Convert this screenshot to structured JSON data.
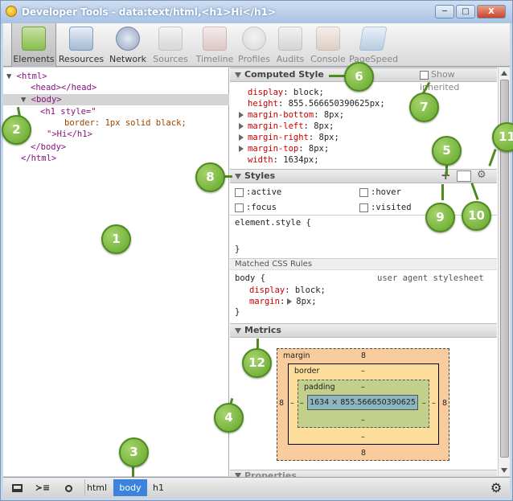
{
  "window": {
    "title": "Developer Tools - data:text/html,<h1>Hi</h1>",
    "buttons": {
      "minimize": "─",
      "maximize": "□",
      "close": "X"
    }
  },
  "toolbar": {
    "tabs": [
      {
        "label": "Elements",
        "icon": "elements-icon"
      },
      {
        "label": "Resources",
        "icon": "resources-icon"
      },
      {
        "label": "Network",
        "icon": "network-icon"
      },
      {
        "label": "Sources",
        "icon": "sources-icon"
      },
      {
        "label": "Timeline",
        "icon": "timeline-icon"
      },
      {
        "label": "Profiles",
        "icon": "profiles-icon"
      },
      {
        "label": "Audits",
        "icon": "audits-icon"
      },
      {
        "label": "Console",
        "icon": "console-icon"
      },
      {
        "label": "PageSpeed",
        "icon": "pagespeed-icon"
      }
    ],
    "selected": "Elements"
  },
  "dom_tree": {
    "lines": [
      "<html>",
      "<head></head>",
      "<body>",
      "<h1 style=\"",
      "border: 1px solid black;",
      "\">Hi</h1>",
      "</body>",
      "</html>"
    ]
  },
  "computed_style": {
    "header": "Computed Style",
    "show_inherited": "Show inherited",
    "props": [
      {
        "name": "display",
        "value": "block;"
      },
      {
        "name": "height",
        "value": "855.566650390625px;"
      },
      {
        "name": "margin-bottom",
        "value": "8px;"
      },
      {
        "name": "margin-left",
        "value": "8px;"
      },
      {
        "name": "margin-right",
        "value": "8px;"
      },
      {
        "name": "margin-top",
        "value": "8px;"
      },
      {
        "name": "width",
        "value": "1634px;"
      }
    ]
  },
  "styles": {
    "header": "Styles",
    "states": [
      ":active",
      ":hover",
      ":focus",
      ":visited"
    ],
    "element_style": "element.style {",
    "element_style_close": "}",
    "matched_header": "Matched CSS Rules",
    "rule_selector": "body {",
    "rule_origin": "user agent stylesheet",
    "rule_props": [
      {
        "name": "display",
        "value": "block;"
      },
      {
        "name": "margin",
        "value": "8px;"
      }
    ],
    "rule_close": "}",
    "add_glyph": "+"
  },
  "metrics": {
    "header": "Metrics",
    "margin_label": "margin",
    "margin_top": "8",
    "margin_left": "8",
    "margin_right": "8",
    "margin_bottom": "8",
    "border_label": "border",
    "border_top": "–",
    "border_left": "–",
    "border_right": "–",
    "border_bottom": "–",
    "padding_label": "padding",
    "padding_top": "–",
    "padding_left": "–",
    "padding_right": "–",
    "padding_bottom": "–",
    "content": "1634 × 855.566650390625",
    "colors": {
      "margin": "#f9cc9d",
      "border": "#fddd9b",
      "padding": "#c3d08b",
      "content": "#8cb6c0"
    }
  },
  "properties": {
    "header": "Properties"
  },
  "bottom_bar": {
    "crumbs": [
      "html",
      "body",
      "h1"
    ],
    "selected": "body"
  },
  "callouts": [
    "1",
    "2",
    "3",
    "4",
    "5",
    "6",
    "7",
    "8",
    "9",
    "10",
    "11",
    "12"
  ],
  "colors": {
    "callout": "#6aae2f",
    "selected_crumb": "#3c83e0",
    "tag": "#881280",
    "property": "#c80000"
  }
}
